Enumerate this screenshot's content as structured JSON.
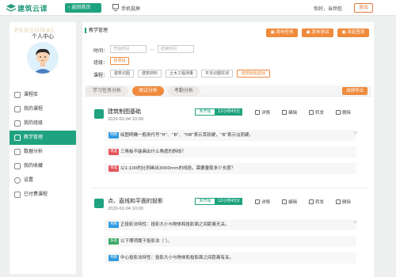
{
  "header": {
    "logo_text": "建筑云课",
    "back_label": "返回首页",
    "mobile_label": "手机投屏",
    "greeting": "你好，当世彪",
    "logout_label": "退出"
  },
  "sidebar": {
    "watermark": "PERSONAL",
    "title": "个人中心",
    "items": [
      {
        "label": "课程库",
        "icon": "cube-icon"
      },
      {
        "label": "我的课程",
        "icon": "book-icon"
      },
      {
        "label": "我的班级",
        "icon": "class-icon"
      },
      {
        "label": "教学管理",
        "icon": "manage-icon"
      },
      {
        "label": "数据分析",
        "icon": "chart-icon"
      },
      {
        "label": "我的收藏",
        "icon": "star-icon"
      },
      {
        "label": "设置",
        "icon": "gear-icon"
      },
      {
        "label": "已付费课程",
        "icon": "pay-icon"
      }
    ],
    "active_index": 3
  },
  "main": {
    "title": "教学管理",
    "actions": [
      "发布任务",
      "发布测试",
      "发起签到"
    ],
    "filters": {
      "time_label": "时间：",
      "start_placeholder": "开始时间",
      "separator": "—",
      "end_placeholder": "结束时间",
      "class_label": "班级：",
      "class_value": "智慧班",
      "course_label": "课程：",
      "courses": [
        "建筑识图",
        "建筑材料",
        "土木工程测量",
        "平法识图实训",
        "建筑制图基础"
      ],
      "selected_course_index": 4
    },
    "tabs": [
      "学习任务分析",
      "测试分析",
      "考勤分析"
    ],
    "active_tab": 1,
    "export_label": "成绩导出",
    "cards": [
      {
        "name": "建筑制图基础",
        "status": "未开始",
        "duration": "12小时43分",
        "date": "2020-02-04 10:00",
        "actions": [
          "详情",
          "编辑",
          "转发",
          "删除"
        ],
        "questions": [
          {
            "type": "判断",
            "color": "#2f9be0",
            "text": "绘图明确一般用代号“H”、“B”、“HB”表示其软硬，“B”表示淡而硬。"
          },
          {
            "type": "单选",
            "color": "#e2555b",
            "text": "三角板不能画出什么角度的斜线？"
          },
          {
            "type": "单选",
            "color": "#e2555b",
            "text": "以1:100的比例画出3000mm的线段，需要量取多少长度？"
          }
        ]
      },
      {
        "name": "点、直线和平面的投影",
        "status": "未开始",
        "duration": "12小时43分",
        "date": "2020-02-04 10:00",
        "actions": [
          "详情",
          "编辑",
          "转发",
          "删除"
        ],
        "questions": [
          {
            "type": "判断",
            "color": "#2f9be0",
            "text": "正投影法特性：投影大小与物体和投影面之间距离无关。"
          },
          {
            "type": "多选",
            "color": "#3aa865",
            "text": "以下哪项属于投影法（ ）。"
          },
          {
            "type": "判断",
            "color": "#2f9be0",
            "text": "中心投影法特性：投影大小与物体和投影面之间距离有关。"
          }
        ]
      }
    ]
  }
}
